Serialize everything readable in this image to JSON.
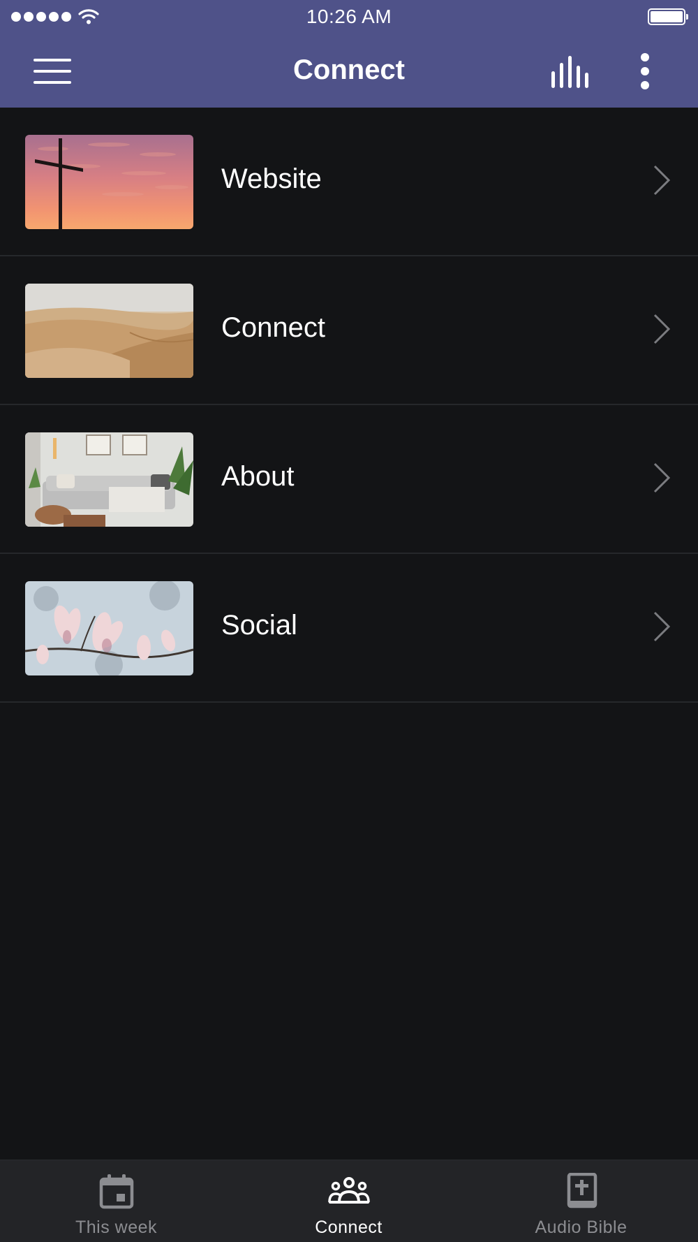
{
  "status_bar": {
    "time": "10:26 AM",
    "signal_icon": "signal-dots-icon",
    "wifi_icon": "wifi-icon",
    "battery_icon": "battery-icon",
    "battery_level": 1.0
  },
  "nav": {
    "title": "Connect",
    "menu_icon": "hamburger-menu-icon",
    "bars_icon": "audio-bars-icon",
    "more_icon": "more-vertical-icon"
  },
  "list": {
    "items": [
      {
        "label": "Website",
        "thumbnail": "cross-at-sunset"
      },
      {
        "label": "Connect",
        "thumbnail": "desert-dunes"
      },
      {
        "label": "About",
        "thumbnail": "living-room"
      },
      {
        "label": "Social",
        "thumbnail": "magnolia-blossoms"
      }
    ],
    "chevron_icon": "chevron-right-icon"
  },
  "tab_bar": {
    "tabs": [
      {
        "label": "This week",
        "icon": "calendar-icon",
        "active": false
      },
      {
        "label": "Connect",
        "icon": "group-icon",
        "active": true
      },
      {
        "label": "Audio Bible",
        "icon": "bible-icon",
        "active": false
      }
    ]
  },
  "colors": {
    "header": "#4f5289",
    "background": "#131416",
    "tab_bar": "#232427",
    "divider": "#26282b",
    "tab_inactive": "#8c8d91",
    "tab_active": "#ffffff"
  }
}
